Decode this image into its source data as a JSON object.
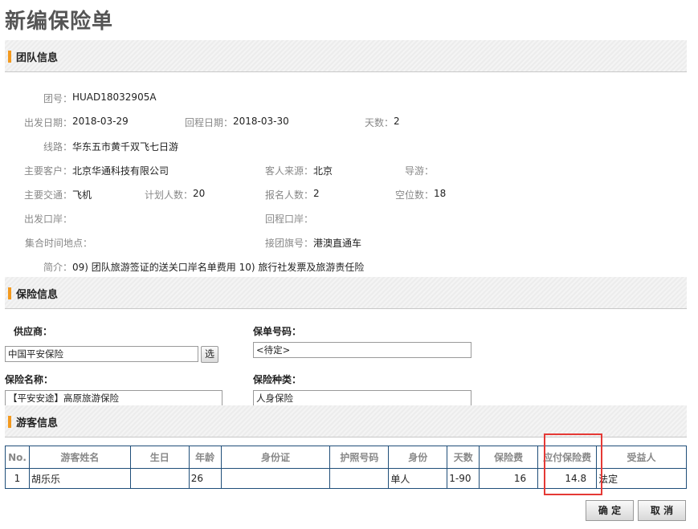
{
  "page": {
    "title": "新编保险单"
  },
  "sections": {
    "team": "团队信息",
    "insurance": "保险信息",
    "tourists": "游客信息"
  },
  "team": {
    "group_no_label": "团号：",
    "group_no": "HUAD18032905A",
    "depart_date_label": "出发日期：",
    "depart_date": "2018-03-29",
    "return_date_label": "回程日期：",
    "return_date": "2018-03-30",
    "days_label": "天数：",
    "days": "2",
    "route_label": "线路：",
    "route": "华东五市黄千双飞七日游",
    "main_client_label": "主要客户：",
    "main_client": "北京华通科技有限公司",
    "source_label": "客人来源：",
    "source": "北京",
    "guide_label": "导游：",
    "guide": "",
    "transport_label": "主要交通：",
    "transport": "飞机",
    "planned_label": "计划人数：",
    "planned": "20",
    "signed_label": "报名人数：",
    "signed": "2",
    "vacancy_label": "空位数：",
    "vacancy": "18",
    "depart_port_label": "出发口岸：",
    "depart_port": "",
    "return_port_label": "回程口岸：",
    "return_port": "",
    "gather_label": "集合时间地点：",
    "gather": "",
    "flag_label": "接团旗号：",
    "flag": "港澳直通车",
    "intro_label": "简介：",
    "intro": "09) 团队旅游签证的送关口岸名单费用 10) 旅行社发票及旅游责任险"
  },
  "insurance": {
    "supplier_label": "供应商：",
    "supplier": "中国平安保险",
    "pick_label": "选",
    "policy_no_label": "保单号码：",
    "policy_no": "<待定>",
    "name_label": "保险名称：",
    "name": "【平安安途】高原旅游保险",
    "type_label": "保险种类：",
    "type": "人身保险"
  },
  "tourists": {
    "headers": [
      "No.",
      "游客姓名",
      "生日",
      "年龄",
      "身份证",
      "护照号码",
      "身份",
      "天数",
      "保险费",
      "应付保险费",
      "受益人"
    ],
    "rows": [
      [
        "1",
        "胡乐乐",
        "",
        "26",
        "",
        "",
        "单人",
        "1-90",
        "16",
        "14.8",
        "法定"
      ]
    ]
  },
  "actions": {
    "confirm": "确 定",
    "cancel": "取 消"
  },
  "colors": {
    "accent": "#f39a1f",
    "table_border": "#1f4e79",
    "highlight": "#e53935"
  }
}
